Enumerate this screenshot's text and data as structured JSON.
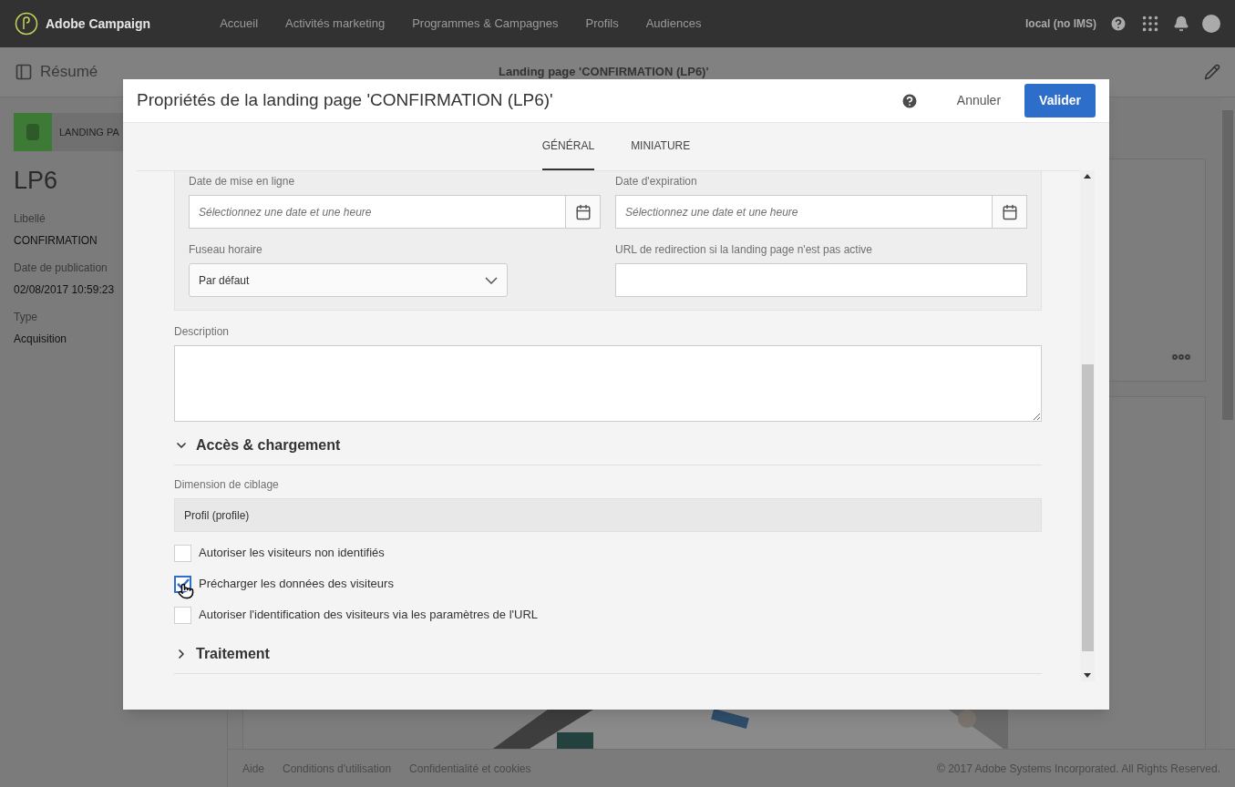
{
  "top_nav": {
    "brand": "Adobe Campaign",
    "items": [
      {
        "label": "Accueil"
      },
      {
        "label": "Activités marketing"
      },
      {
        "label": "Programmes & Campagnes"
      },
      {
        "label": "Profils"
      },
      {
        "label": "Audiences"
      }
    ],
    "instance": "local (no IMS)"
  },
  "sub_header": {
    "summary": "Résumé",
    "page_title": "Landing page 'CONFIRMATION (LP6)'"
  },
  "summary_panel": {
    "badge": "LANDING PA",
    "name": "LP6",
    "fields": [
      {
        "label": "Libellé",
        "value": "CONFIRMATION"
      },
      {
        "label": "Date de publication",
        "value": "02/08/2017 10:59:23"
      },
      {
        "label": "Type",
        "value": "Acquisition"
      }
    ]
  },
  "dialog": {
    "title": "Propriétés de la landing page 'CONFIRMATION (LP6)'",
    "cancel": "Annuler",
    "confirm": "Valider",
    "tabs": [
      {
        "label": "GÉNÉRAL",
        "selected": true
      },
      {
        "label": "MINIATURE",
        "selected": false
      }
    ],
    "start_date": {
      "label": "Date de mise en ligne",
      "placeholder": "Sélectionnez une date et une heure"
    },
    "end_date": {
      "label": "Date d'expiration",
      "placeholder": "Sélectionnez une date et une heure"
    },
    "timezone": {
      "label": "Fuseau horaire",
      "value": "Par défaut"
    },
    "redirect_url": {
      "label": "URL de redirection si la landing page n'est pas active"
    },
    "description": {
      "label": "Description"
    },
    "sections": [
      {
        "title": "Accès & chargement",
        "expanded": true
      },
      {
        "title": "Traitement",
        "expanded": false
      }
    ],
    "targeting_dimension": {
      "label": "Dimension de ciblage",
      "value": "Profil (profile)"
    },
    "options": [
      {
        "label": "Autoriser les visiteurs non identifiés",
        "checked": false
      },
      {
        "label": "Précharger les données des visiteurs",
        "checked": true
      },
      {
        "label": "Autoriser l'identification des visiteurs via les paramètres de l'URL",
        "checked": false
      }
    ]
  },
  "footer": {
    "links": [
      {
        "label": "Aide"
      },
      {
        "label": "Conditions d'utilisation"
      },
      {
        "label": "Confidentialité et cookies"
      }
    ],
    "copyright": "© 2017 Adobe Systems Incorporated. All Rights Reserved."
  }
}
